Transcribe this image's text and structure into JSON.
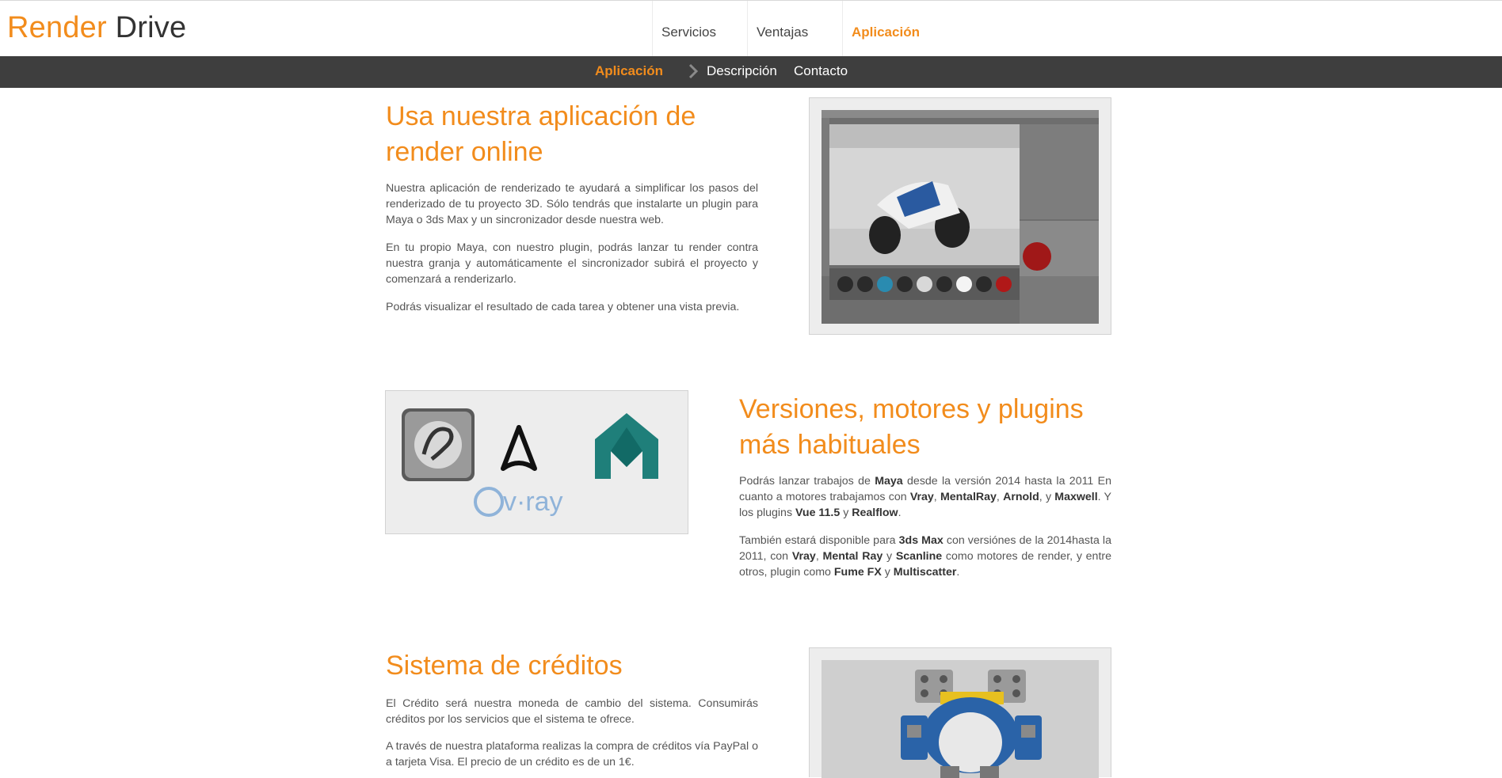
{
  "brand": {
    "part1": "Render",
    "part2": "Drive"
  },
  "main_nav": [
    "Servicios",
    "Ventajas",
    "Aplicación"
  ],
  "sub_nav": [
    "Aplicación",
    "Descripción",
    "Contacto"
  ],
  "colors": {
    "accent": "#f28c1c",
    "subnav_bg": "#3e3e3e",
    "text": "#555555"
  },
  "section1": {
    "title_line1": "Usa nuestra aplicación de",
    "title_line2": "render online",
    "p1": "Nuestra aplicación de renderizado te ayudará a simplificar los pasos del renderizado de tu proyecto 3D. Sólo tendrás que instalarte un plugin para Maya o 3ds Max y un sincronizador desde nuestra web.",
    "p2": "En tu propio Maya, con nuestro plugin, podrás lanzar tu render contra nuestra granja y automáticamente el sincronizador subirá el proyecto y comenzará a renderizarlo.",
    "p3": "Podrás visualizar el resultado de cada tarea y obtener una vista previa."
  },
  "section2": {
    "title_line1": "Versiones, motores y plugins",
    "title_line2": "más habituales",
    "p1": {
      "t1": "Podrás lanzar trabajos de ",
      "b1": "Maya",
      "t2": " desde la versión 2014 hasta la 2011 En cuanto a motores trabajamos con ",
      "b2": "Vray",
      "t3": ", ",
      "b3": "MentalRay",
      "t4": ", ",
      "b4": "Arnold",
      "t5": ", y ",
      "b5": "Maxwell",
      "t6": ". Y los plugins ",
      "b6": "Vue 11.5",
      "t7": " y ",
      "b7": "Realflow",
      "t8": "."
    },
    "p2": {
      "t1": "También estará disponible para ",
      "b1": "3ds Max",
      "t2": " con versiónes de la 2014hasta la 2011, con ",
      "b2": "Vray",
      "t3": ", ",
      "b3": "Mental Ray",
      "t4": " y ",
      "b4": "Scanline",
      "t5": " como motores de render, y entre otros, plugin como ",
      "b5": "Fume FX",
      "t6": " y ",
      "b6": "Multiscatter",
      "t7": "."
    },
    "logos": {
      "vray_text": "v·ray"
    }
  },
  "section3": {
    "title": "Sistema de créditos",
    "p1": "El Crédito será nuestra moneda de cambio del sistema. Consumirás créditos por los servicios que el sistema te ofrece.",
    "p2": "A través de nuestra plataforma realizas la compra de créditos vía PayPal o a tarjeta Visa. El precio de un crédito es de un 1€."
  }
}
